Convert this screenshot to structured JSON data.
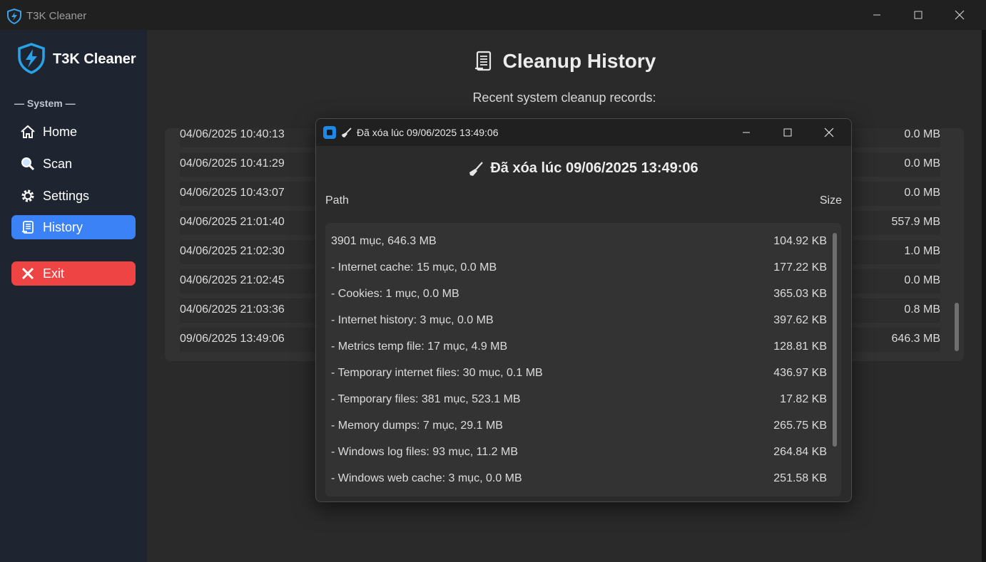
{
  "window": {
    "title": "T3K Cleaner"
  },
  "sidebar": {
    "brand": "T3K Cleaner",
    "section_label": "— System —",
    "items": [
      {
        "label": "Home",
        "icon": "home-icon",
        "active": false
      },
      {
        "label": "Scan",
        "icon": "search-icon",
        "active": false
      },
      {
        "label": "Settings",
        "icon": "gear-icon",
        "active": false
      },
      {
        "label": "History",
        "icon": "scroll-icon",
        "active": true
      }
    ],
    "exit_label": "Exit"
  },
  "main": {
    "title": "Cleanup History",
    "subtitle": "Recent system cleanup records:",
    "records": [
      {
        "date": "04/06/2025 10:40:13",
        "size": "0.0 MB"
      },
      {
        "date": "04/06/2025 10:41:29",
        "size": "0.0 MB"
      },
      {
        "date": "04/06/2025 10:43:07",
        "size": "0.0 MB"
      },
      {
        "date": "04/06/2025 21:01:40",
        "size": "557.9 MB"
      },
      {
        "date": "04/06/2025 21:02:30",
        "size": "1.0 MB"
      },
      {
        "date": "04/06/2025 21:02:45",
        "size": "0.0 MB"
      },
      {
        "date": "04/06/2025 21:03:36",
        "size": "0.8 MB"
      },
      {
        "date": "09/06/2025 13:49:06",
        "size": "646.3 MB"
      }
    ]
  },
  "dialog": {
    "title": "Đã xóa lúc 09/06/2025 13:49:06",
    "heading": "Đã xóa lúc 09/06/2025 13:49:06",
    "col_path": "Path",
    "col_size": "Size",
    "items": [
      {
        "path": "3901 mục, 646.3 MB",
        "size": "104.92 KB"
      },
      {
        "path": "- Internet cache: 15 mục, 0.0 MB",
        "size": "177.22 KB"
      },
      {
        "path": "- Cookies: 1 mục, 0.0 MB",
        "size": "365.03 KB"
      },
      {
        "path": "- Internet history: 3 mục, 0.0 MB",
        "size": "397.62 KB"
      },
      {
        "path": "- Metrics temp file: 17 mục, 4.9 MB",
        "size": "128.81 KB"
      },
      {
        "path": "- Temporary internet files: 30 mục, 0.1 MB",
        "size": "436.97 KB"
      },
      {
        "path": "- Temporary files: 381 mục, 523.1 MB",
        "size": "17.82 KB"
      },
      {
        "path": "- Memory dumps: 7 mục, 29.1 MB",
        "size": "265.75 KB"
      },
      {
        "path": "- Windows log files: 93 mục, 11.2 MB",
        "size": "264.84 KB"
      },
      {
        "path": "- Windows web cache: 3 mục, 0.0 MB",
        "size": "251.58 KB"
      }
    ]
  },
  "colors": {
    "accent": "#3b82f6",
    "exit": "#ef4444",
    "sidebar_bg": "#1f2530",
    "main_bg": "#2a2a2a"
  }
}
